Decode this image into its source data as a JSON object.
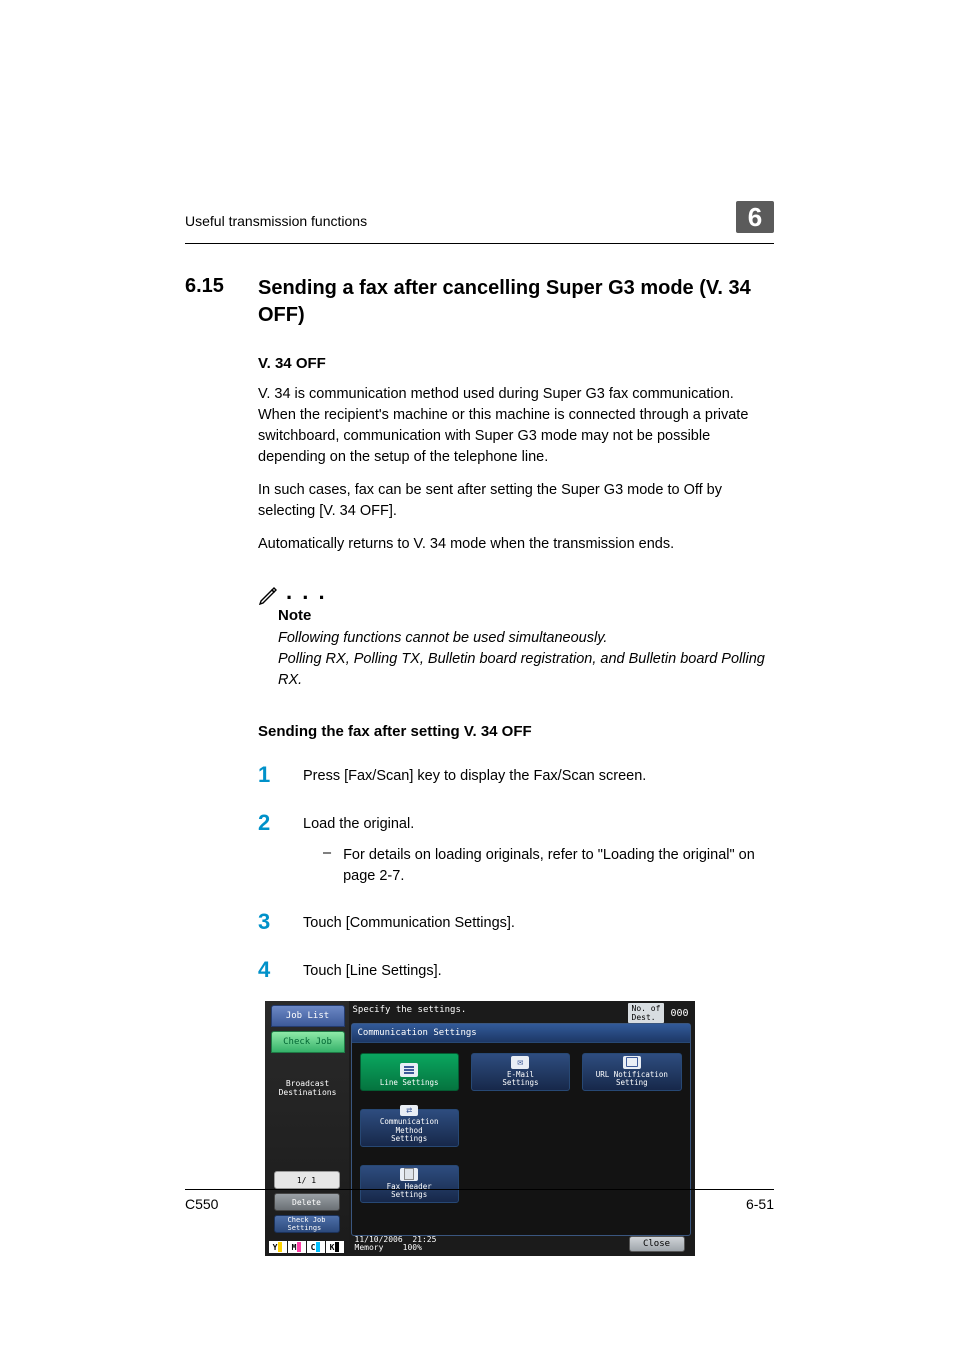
{
  "running_header": {
    "text": "Useful transmission functions",
    "chapter_number": "6"
  },
  "heading": {
    "number": "6.15",
    "title": "Sending a fax after cancelling Super G3 mode (V. 34 OFF)"
  },
  "sub_heading": "V. 34 OFF",
  "paragraphs": [
    "V. 34 is communication method used during Super G3 fax communication. When the recipient's machine or this machine is connected through a private switchboard, communication with Super G3 mode may not be possible depending on the setup of the telephone line.",
    "In such cases, fax can be sent after setting the Super G3 mode to Off by selecting [V. 34 OFF].",
    "Automatically returns to V. 34 mode when the transmission ends."
  ],
  "note": {
    "label": "Note",
    "text": "Following functions cannot be used simultaneously.\nPolling RX, Polling TX, Bulletin board registration, and Bulletin board Polling RX."
  },
  "procedure": {
    "heading": "Sending the fax after setting V. 34 OFF",
    "steps": [
      {
        "num": "1",
        "text": "Press [Fax/Scan] key to display the Fax/Scan screen."
      },
      {
        "num": "2",
        "text": "Load the original.",
        "sub": "For details on loading originals, refer to \"Loading the original\" on page 2-7."
      },
      {
        "num": "3",
        "text": "Touch [Communication Settings]."
      },
      {
        "num": "4",
        "text": "Touch [Line Settings]."
      }
    ]
  },
  "device": {
    "top_instruction": "Specify the settings.",
    "dest_label": "No. of\nDest.",
    "dest_count": "000",
    "left": {
      "job_list": "Job List",
      "check_job": "Check Job",
      "broadcast": "Broadcast\nDestinations",
      "page": "1/ 1",
      "delete": "Delete",
      "check_settings": "Check Job\nSettings",
      "toner": [
        "Y",
        "M",
        "C",
        "K"
      ]
    },
    "panel_title": "Communication Settings",
    "buttons": {
      "line": "Line Settings",
      "email": "E-Mail\nSettings",
      "url": "URL Notification\nSetting",
      "method": "Communication Method\nSettings",
      "fax_header": "Fax Header\nSettings"
    },
    "close": "Close",
    "date": "11/10/2006",
    "time": "21:25",
    "memory_label": "Memory",
    "memory_value": "100%"
  },
  "footer": {
    "left": "C550",
    "right": "6-51"
  }
}
